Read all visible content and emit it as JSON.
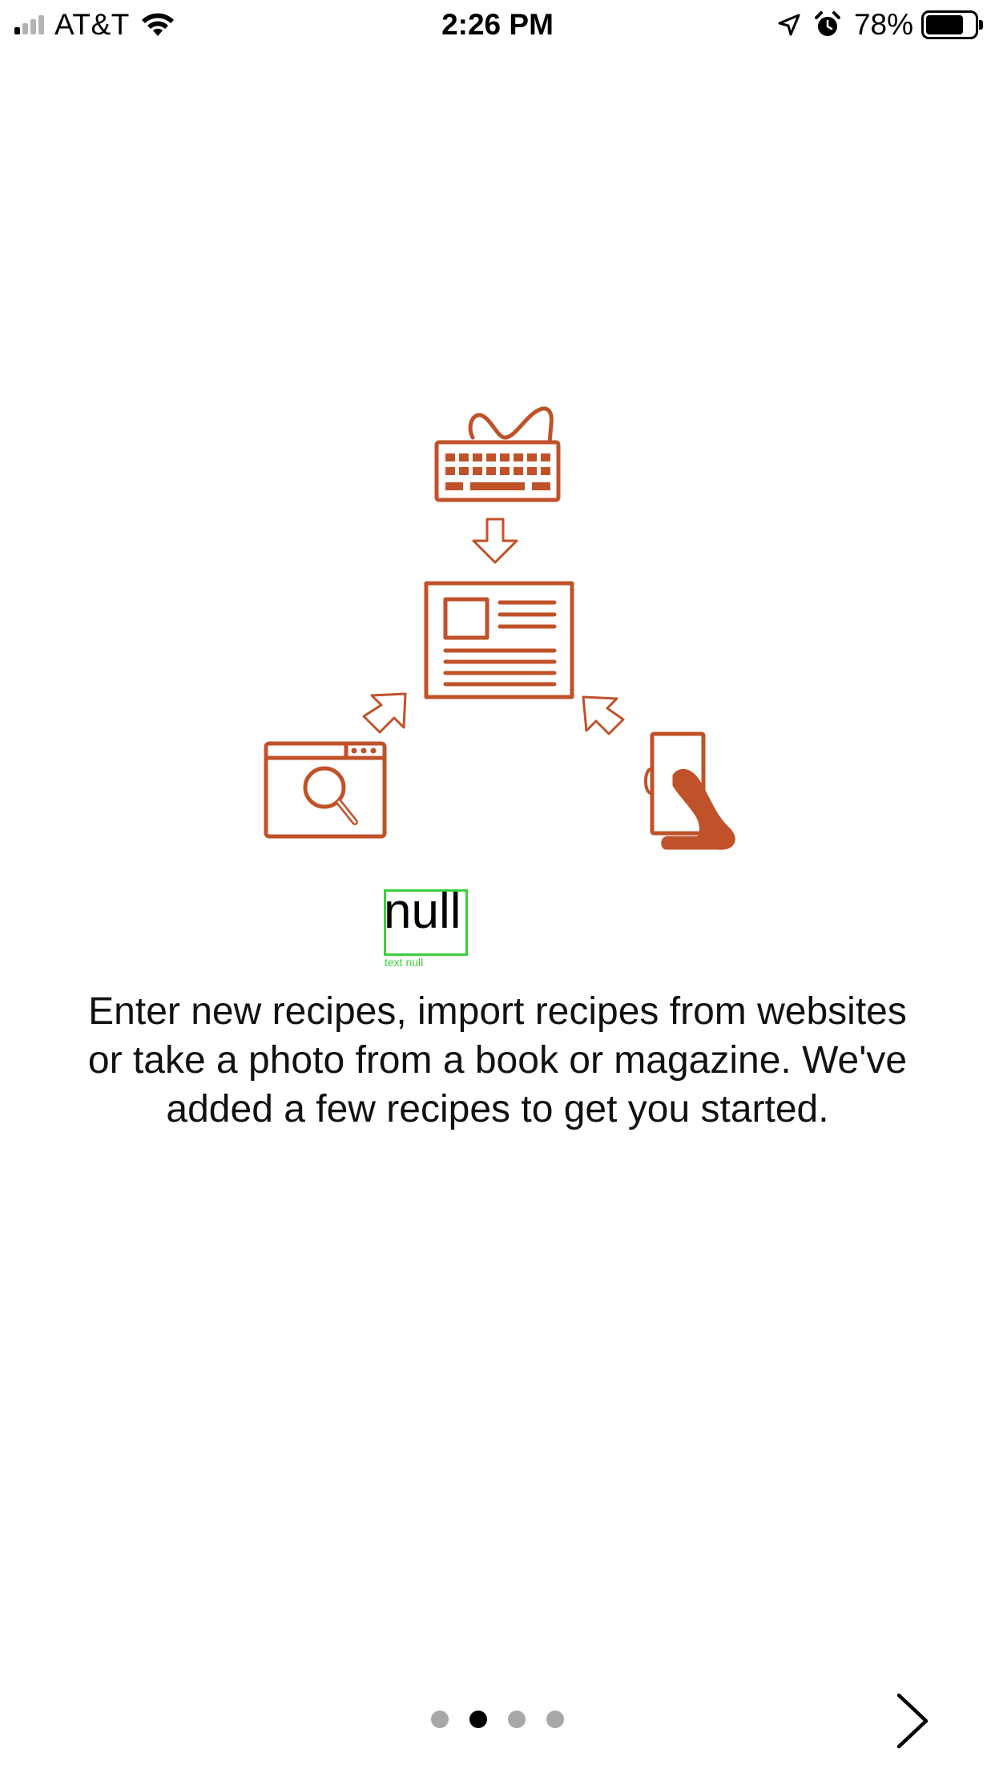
{
  "status_bar": {
    "carrier": "AT&T",
    "time": "2:26 PM",
    "battery_percent": "78%",
    "battery_level": 0.78,
    "signal_bars_active": 1,
    "signal_bars_total": 4,
    "icons": [
      "signal-icon",
      "wifi-icon",
      "location-arrow-icon",
      "alarm-icon",
      "battery-icon"
    ]
  },
  "onboarding": {
    "title": "null",
    "debug_label": "text null",
    "description": "Enter new recipes, import recipes from websites or take a photo from a book or magazine. We've added a few recipes to get you started.",
    "illustration_icons": [
      "keyboard-icon",
      "down-arrow-icon",
      "recipe-card-icon",
      "browser-search-icon",
      "up-right-arrow-icon",
      "up-left-arrow-icon",
      "hand-phone-icon"
    ],
    "accent_color": "#c0522a"
  },
  "page_control": {
    "page_count": 4,
    "current_page_index": 1
  },
  "navigation": {
    "next_icon": "chevron-right-icon"
  }
}
